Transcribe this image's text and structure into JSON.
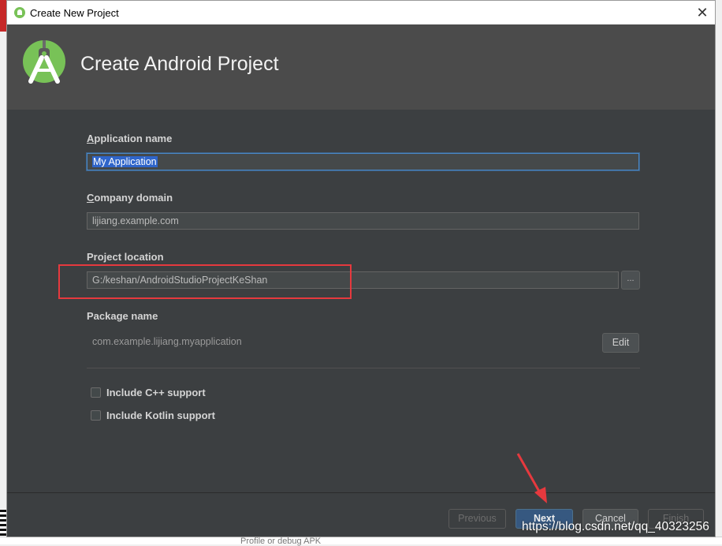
{
  "window": {
    "title": "Create New Project",
    "close_glyph": "✕"
  },
  "header": {
    "title": "Create Android Project",
    "logo_icon": "android-studio-logo"
  },
  "form": {
    "app_name": {
      "label_mnemonic": "A",
      "label_rest": "pplication name",
      "value": "My Application"
    },
    "company_domain": {
      "label_mnemonic": "C",
      "label_rest": "ompany domain",
      "value": "lijiang.example.com"
    },
    "project_location": {
      "label": "Project location",
      "value": "G:/keshan/AndroidStudioProjectKeShan",
      "browse_label": "..."
    },
    "package_name": {
      "label": "Package name",
      "value": "com.example.lijiang.myapplication",
      "edit_label": "Edit"
    },
    "options": [
      {
        "label": "Include C++ support",
        "checked": false
      },
      {
        "label": "Include Kotlin support",
        "checked": false
      }
    ]
  },
  "footer": {
    "previous": "Previous",
    "next": "Next",
    "cancel": "Cancel",
    "finish": "Finish"
  },
  "background": {
    "partial_text": "Profile or debug APK"
  },
  "watermark": "https://blog.csdn.net/qq_40323256",
  "colors": {
    "dialog_bg": "#3c3f41",
    "header_bg": "#4b4b4b",
    "accent": "#4a88c7",
    "annotation_red": "#e6393e"
  }
}
